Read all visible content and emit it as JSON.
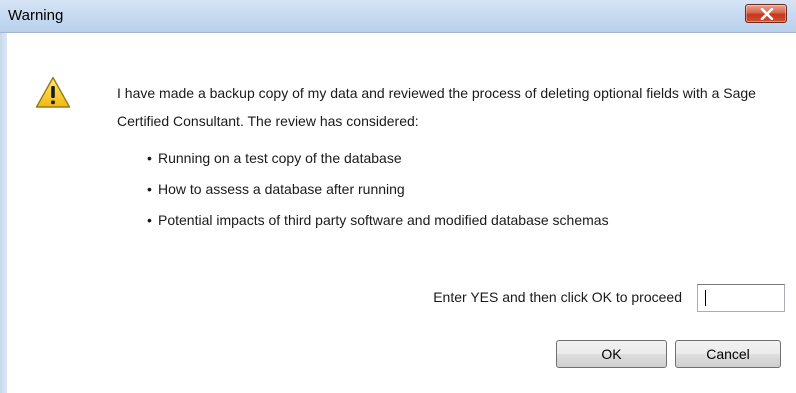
{
  "window": {
    "title": "Warning"
  },
  "icons": {
    "main": "warning-triangle-icon",
    "close": "close-x-icon"
  },
  "message": {
    "text": "I have made a backup copy of my data and reviewed the process of deleting optional fields with a Sage Certified Consultant. The review has considered:",
    "bullet_glyph": "•",
    "bullets": [
      "Running on a test copy of the database",
      "How to assess a database after running",
      "Potential impacts of third party software and modified database schemas"
    ]
  },
  "prompt": {
    "label": "Enter YES and then click OK to proceed",
    "input_value": ""
  },
  "buttons": {
    "ok_label": "OK",
    "cancel_label": "Cancel"
  },
  "colors": {
    "titlebar": "#c7daf0",
    "close_button": "#c3391d",
    "warning_yellow": "#f6cc2e"
  }
}
